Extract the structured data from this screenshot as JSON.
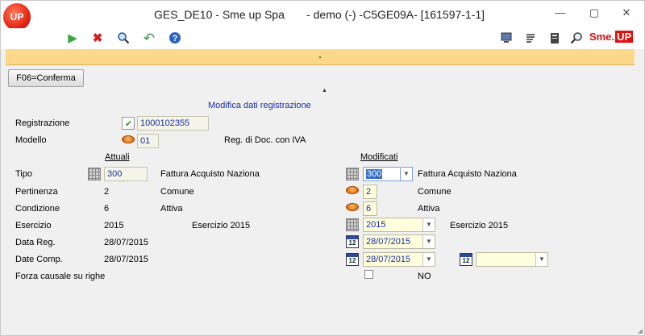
{
  "window": {
    "title": "GES_DE10 - Sme up Spa       - demo (-) -C5GE09A- [161597-1-1]",
    "logo_text": "UP",
    "minimize": "—",
    "maximize": "▢",
    "close": "✕"
  },
  "toolbar": {
    "brand": "Sme.",
    "brand_badge": "UP",
    "accent": "#e01010"
  },
  "message_bar": {
    "text": "-"
  },
  "actions": {
    "confirm_label": "F06=Conferma"
  },
  "form": {
    "title": "Modifica dati registrazione",
    "registrazione": {
      "label": "Registrazione",
      "value": "1000102355"
    },
    "modello": {
      "label": "Modello",
      "value": "01",
      "description": "Reg. di Doc. con IVA"
    },
    "headers": {
      "attuali": "Attuali",
      "modificati": "Modificati"
    },
    "rows": {
      "tipo": {
        "label": "Tipo",
        "current_value": "300",
        "current_desc": "Fattura Acquisto Naziona",
        "new_value": "300",
        "new_desc": "Fattura Acquisto Naziona"
      },
      "pertinenza": {
        "label": "Pertinenza",
        "current_value": "2",
        "current_desc": "Comune",
        "new_value": "2",
        "new_desc": "Comune"
      },
      "condizione": {
        "label": "Condizione",
        "current_value": "6",
        "current_desc": "Attiva",
        "new_value": "6",
        "new_desc": "Attiva"
      },
      "esercizio": {
        "label": "Esercizio",
        "current_value": "2015",
        "current_desc": "Esercizio 2015",
        "new_value": "2015",
        "new_desc": "Esercizio 2015"
      },
      "data_reg": {
        "label": "Data Reg.",
        "current_value": "28/07/2015",
        "new_value": "28/07/2015"
      },
      "date_comp": {
        "label": "Date Comp.",
        "current_value": "28/07/2015",
        "new_value_from": "28/07/2015",
        "new_value_to": ""
      },
      "forza_causale": {
        "label": "Forza causale su righe",
        "new_value": "NO"
      }
    },
    "calendar_icon_text": "12"
  }
}
